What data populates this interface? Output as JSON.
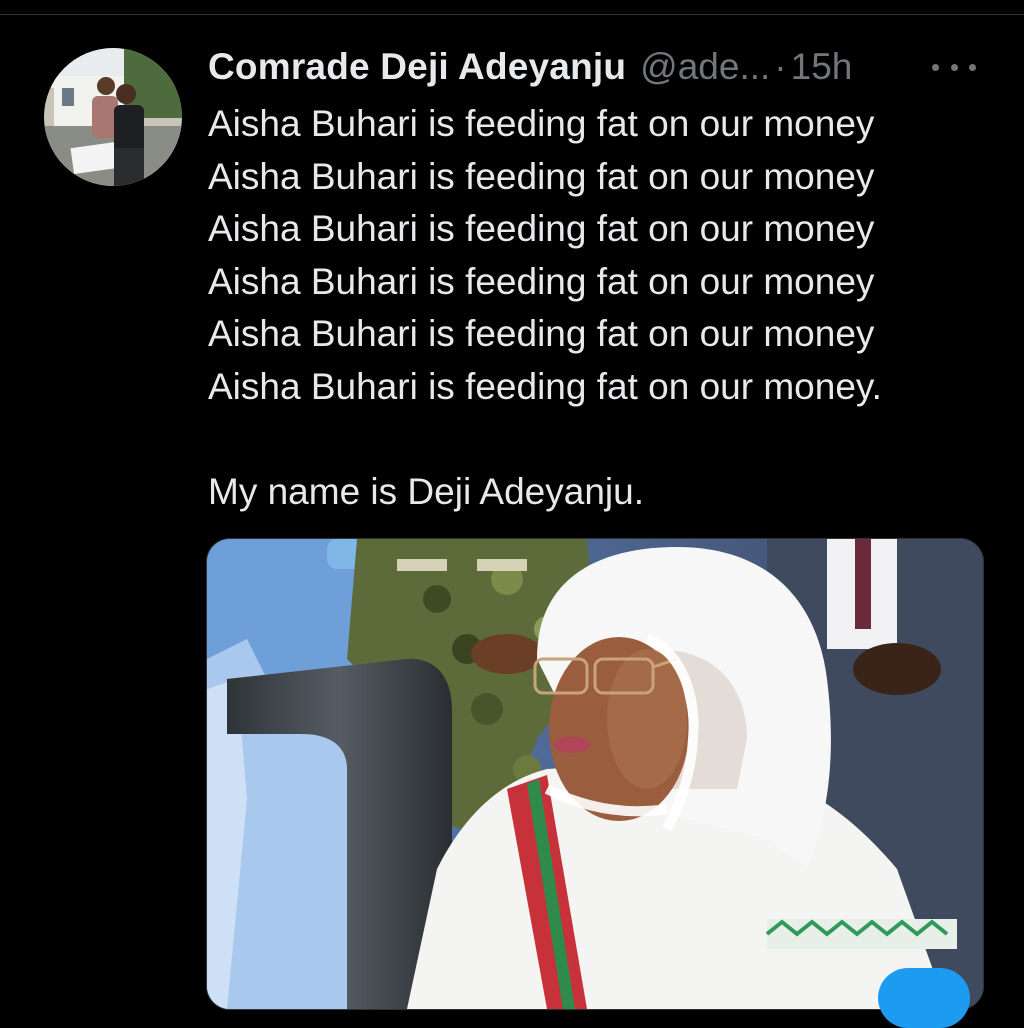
{
  "tweet": {
    "author_name": "Comrade Deji Adeyanju",
    "author_handle": "@ade...",
    "separator": "·",
    "timestamp": "15h",
    "lines": [
      "Aisha Buhari is feeding fat on our money",
      "Aisha Buhari is feeding fat on our money",
      "Aisha Buhari is feeding fat on our money",
      "Aisha Buhari is feeding fat on our money",
      "Aisha Buhari is feeding fat on our money",
      "Aisha Buhari is feeding fat on our money."
    ],
    "closing_line": "My name is Deji Adeyanju."
  },
  "icons": {
    "more": "more-horizontal-icon"
  },
  "colors": {
    "background": "#000000",
    "primary_text": "#e7e9ea",
    "secondary_text": "#71767b",
    "divider": "#2f3336",
    "accent": "#1d9bf0"
  }
}
